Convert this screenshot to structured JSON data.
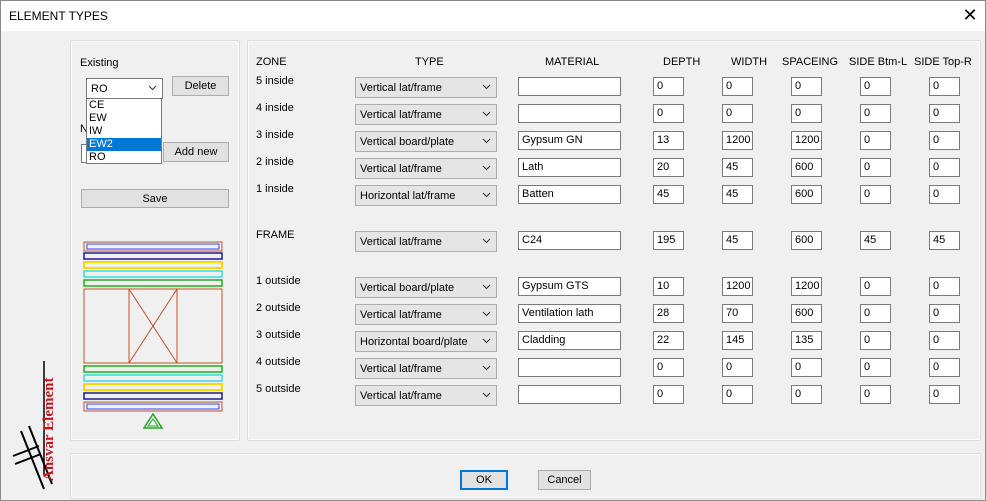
{
  "window": {
    "title": "ELEMENT TYPES"
  },
  "left": {
    "existing_label": "Existing",
    "existing_value": "RO",
    "delete_label": "Delete",
    "new_label": "N",
    "add_new_label": "Add new",
    "save_label": "Save",
    "options": [
      "CE",
      "EW",
      "IW",
      "EW2",
      "RO"
    ],
    "selected_option": "EW2",
    "logo_text": "Ansvar Element"
  },
  "headers": {
    "zone": "ZONE",
    "type": "TYPE",
    "material": "MATERIAL",
    "depth": "DEPTH",
    "width": "WIDTH",
    "spaceing": "SPACEING",
    "side_btm": "SIDE Btm-L",
    "side_top": "SIDE Top-R"
  },
  "rows": [
    {
      "zone": "5 inside",
      "type": "Vertical lat/frame",
      "material": "",
      "depth": "0",
      "width": "0",
      "spacing": "0",
      "side_btm": "0",
      "side_top": "0"
    },
    {
      "zone": "4 inside",
      "type": "Vertical lat/frame",
      "material": "",
      "depth": "0",
      "width": "0",
      "spacing": "0",
      "side_btm": "0",
      "side_top": "0"
    },
    {
      "zone": "3 inside",
      "type": "Vertical board/plate",
      "material": "Gypsum GN",
      "depth": "13",
      "width": "1200",
      "spacing": "1200",
      "side_btm": "0",
      "side_top": "0"
    },
    {
      "zone": "2 inside",
      "type": "Vertical lat/frame",
      "material": "Lath",
      "depth": "20",
      "width": "45",
      "spacing": "600",
      "side_btm": "0",
      "side_top": "0"
    },
    {
      "zone": "1 inside",
      "type": "Horizontal lat/frame",
      "material": "Batten",
      "depth": "45",
      "width": "45",
      "spacing": "600",
      "side_btm": "0",
      "side_top": "0"
    },
    {
      "zone": "FRAME",
      "type": "Vertical lat/frame",
      "material": "C24",
      "depth": "195",
      "width": "45",
      "spacing": "600",
      "side_btm": "45",
      "side_top": "45"
    },
    {
      "zone": "1 outside",
      "type": "Vertical board/plate",
      "material": "Gypsum GTS",
      "depth": "10",
      "width": "1200",
      "spacing": "1200",
      "side_btm": "0",
      "side_top": "0"
    },
    {
      "zone": "2 outside",
      "type": "Vertical lat/frame",
      "material": "Ventilation lath",
      "depth": "28",
      "width": "70",
      "spacing": "600",
      "side_btm": "0",
      "side_top": "0"
    },
    {
      "zone": "3 outside",
      "type": "Horizontal board/plate",
      "material": "Cladding",
      "depth": "22",
      "width": "145",
      "spacing": "135",
      "side_btm": "0",
      "side_top": "0"
    },
    {
      "zone": "4 outside",
      "type": "Vertical lat/frame",
      "material": "",
      "depth": "0",
      "width": "0",
      "spacing": "0",
      "side_btm": "0",
      "side_top": "0"
    },
    {
      "zone": "5 outside",
      "type": "Vertical lat/frame",
      "material": "",
      "depth": "0",
      "width": "0",
      "spacing": "0",
      "side_btm": "0",
      "side_top": "0"
    }
  ],
  "footer": {
    "ok_label": "OK",
    "cancel_label": "Cancel"
  }
}
